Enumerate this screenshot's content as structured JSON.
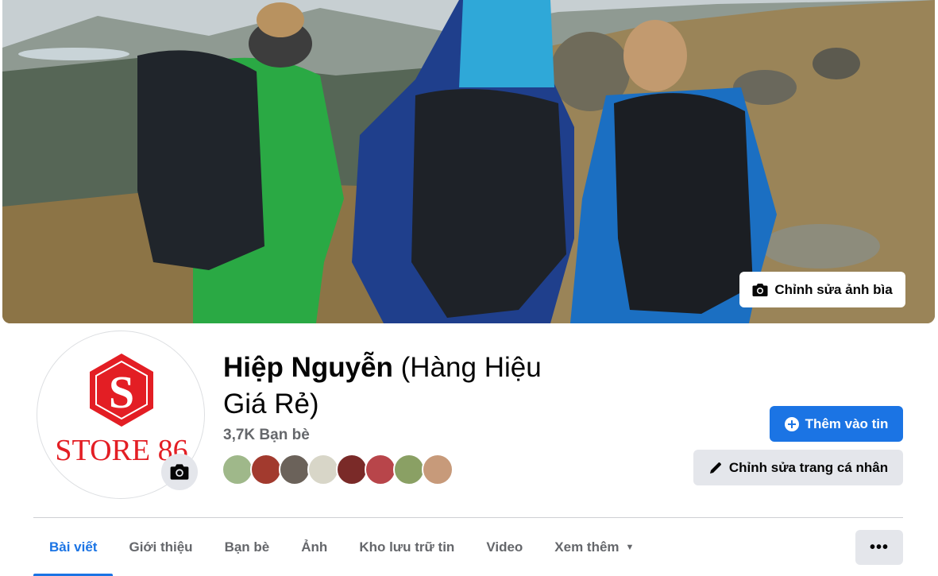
{
  "cover": {
    "edit_label": "Chỉnh sửa ảnh bìa"
  },
  "profile": {
    "name_main": "Hiệp Nguyễn",
    "name_sub_line1": "(Hàng Hiệu",
    "name_sub_line2": "Giá Rẻ)",
    "friends_count": "3,7K Bạn bè",
    "avatar_logo_text": "STORE 86"
  },
  "actions": {
    "add_story_label": "Thêm vào tin",
    "edit_profile_label": "Chỉnh sửa trang cá nhân"
  },
  "tabs": [
    {
      "label": "Bài viết"
    },
    {
      "label": "Giới thiệu"
    },
    {
      "label": "Bạn bè"
    },
    {
      "label": "Ảnh"
    },
    {
      "label": "Kho lưu trữ tin"
    },
    {
      "label": "Video"
    },
    {
      "label": "Xem thêm"
    }
  ],
  "more_menu": "•••",
  "colors": {
    "accent": "#1b74e4",
    "secondary_button": "#e4e6eb",
    "muted_text": "#65676b",
    "logo_red": "#e31e24"
  },
  "icons": {
    "camera": "camera-icon",
    "plus": "plus-circle-icon",
    "pencil": "pencil-icon",
    "caret": "caret-down-icon"
  }
}
